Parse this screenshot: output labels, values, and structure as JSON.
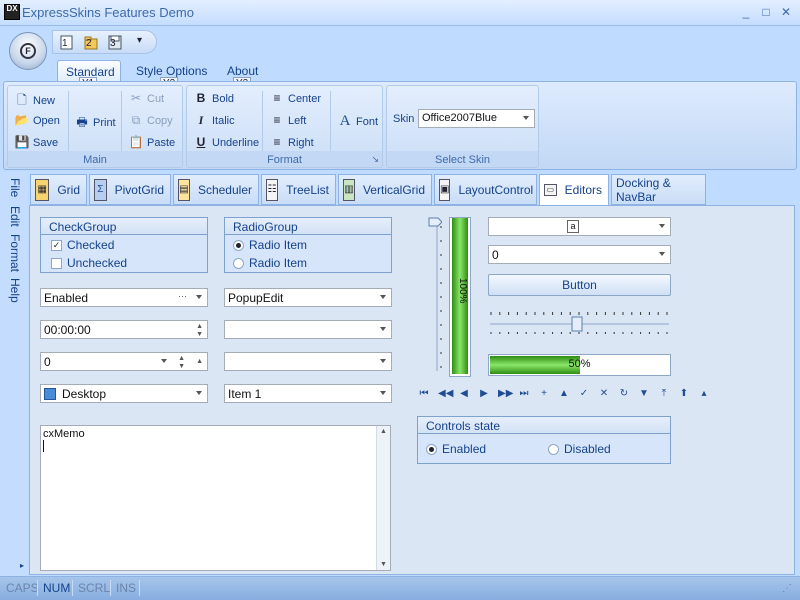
{
  "window": {
    "title": "ExpressSkins Features Demo",
    "icon_text": "DX",
    "minimize": "_",
    "maximize": "□",
    "close": "✕"
  },
  "app_button": {
    "letter": "F"
  },
  "qat": {
    "items": [
      {
        "label": "1",
        "keytip": ""
      },
      {
        "label": "2",
        "keytip": ""
      },
      {
        "label": "3",
        "keytip": ""
      }
    ],
    "customize": "▾"
  },
  "ribbon": {
    "tabs": [
      {
        "label": "Standard",
        "keytip": "Y1"
      },
      {
        "label": "Style Options",
        "keytip": "Y2"
      },
      {
        "label": "About",
        "keytip": "Y3"
      }
    ],
    "groups": {
      "main": {
        "caption": "Main",
        "new": "New",
        "open": "Open",
        "save": "Save",
        "print": "Print",
        "cut": "Cut",
        "copy": "Copy",
        "paste": "Paste"
      },
      "format": {
        "caption": "Format",
        "bold": "Bold",
        "italic": "Italic",
        "underline": "Underline",
        "center": "Center",
        "left": "Left",
        "right": "Right",
        "font": "Font",
        "launcher": "↘"
      },
      "skin": {
        "caption": "Select Skin",
        "label": "Skin",
        "value": "Office2007Blue"
      }
    }
  },
  "side_tabs": [
    "File",
    "Edit",
    "Format",
    "Help"
  ],
  "page_tabs": [
    {
      "label": "Grid"
    },
    {
      "label": "PivotGrid"
    },
    {
      "label": "Scheduler"
    },
    {
      "label": "TreeList"
    },
    {
      "label": "VerticalGrid"
    },
    {
      "label": "LayoutControl"
    },
    {
      "label": "Editors"
    },
    {
      "label": "Docking & NavBar"
    }
  ],
  "editors": {
    "check_group": {
      "caption": "CheckGroup",
      "items": [
        {
          "label": "Checked",
          "checked": true
        },
        {
          "label": "Unchecked",
          "checked": false
        }
      ]
    },
    "radio_group": {
      "caption": "RadioGroup",
      "items": [
        {
          "label": "Radio Item",
          "selected": true
        },
        {
          "label": "Radio Item",
          "selected": false
        }
      ]
    },
    "button_edit": {
      "value": "Enabled",
      "ellipsis": "···"
    },
    "popup_edit": {
      "value": "PopupEdit"
    },
    "time_edit": {
      "value": "00:00:00"
    },
    "blank_combo": {
      "value": ""
    },
    "spin_edit": {
      "value": "0"
    },
    "date_edit": {
      "value": " / /     : :"
    },
    "shell_combo": {
      "value": "Desktop"
    },
    "combo_item": {
      "value": "Item 1"
    },
    "memo": {
      "value": "cxMemo"
    },
    "image_combo": {
      "value": "a"
    },
    "right_combo": {
      "value": "0"
    },
    "button": {
      "label": "Button"
    },
    "vertical_progress": {
      "label": "100%",
      "percent": 100
    },
    "trackbar": {
      "position": 0.5
    },
    "horizontal_progress": {
      "label": "50%",
      "percent": 50
    },
    "navigator": [
      "⏮",
      "◀◀",
      "◀",
      "▶",
      "▶▶",
      "⏭",
      "+",
      "▲",
      "✓",
      "✕",
      "↻",
      "▼",
      "⤒",
      "⬆",
      "▴"
    ],
    "controls_state": {
      "caption": "Controls state",
      "items": [
        {
          "label": "Enabled",
          "selected": true
        },
        {
          "label": "Disabled",
          "selected": false
        }
      ]
    }
  },
  "status_bar": {
    "items": [
      {
        "label": "CAPS",
        "on": false
      },
      {
        "label": "NUM",
        "on": true
      },
      {
        "label": "SCRL",
        "on": false
      },
      {
        "label": "INS",
        "on": false
      }
    ]
  }
}
